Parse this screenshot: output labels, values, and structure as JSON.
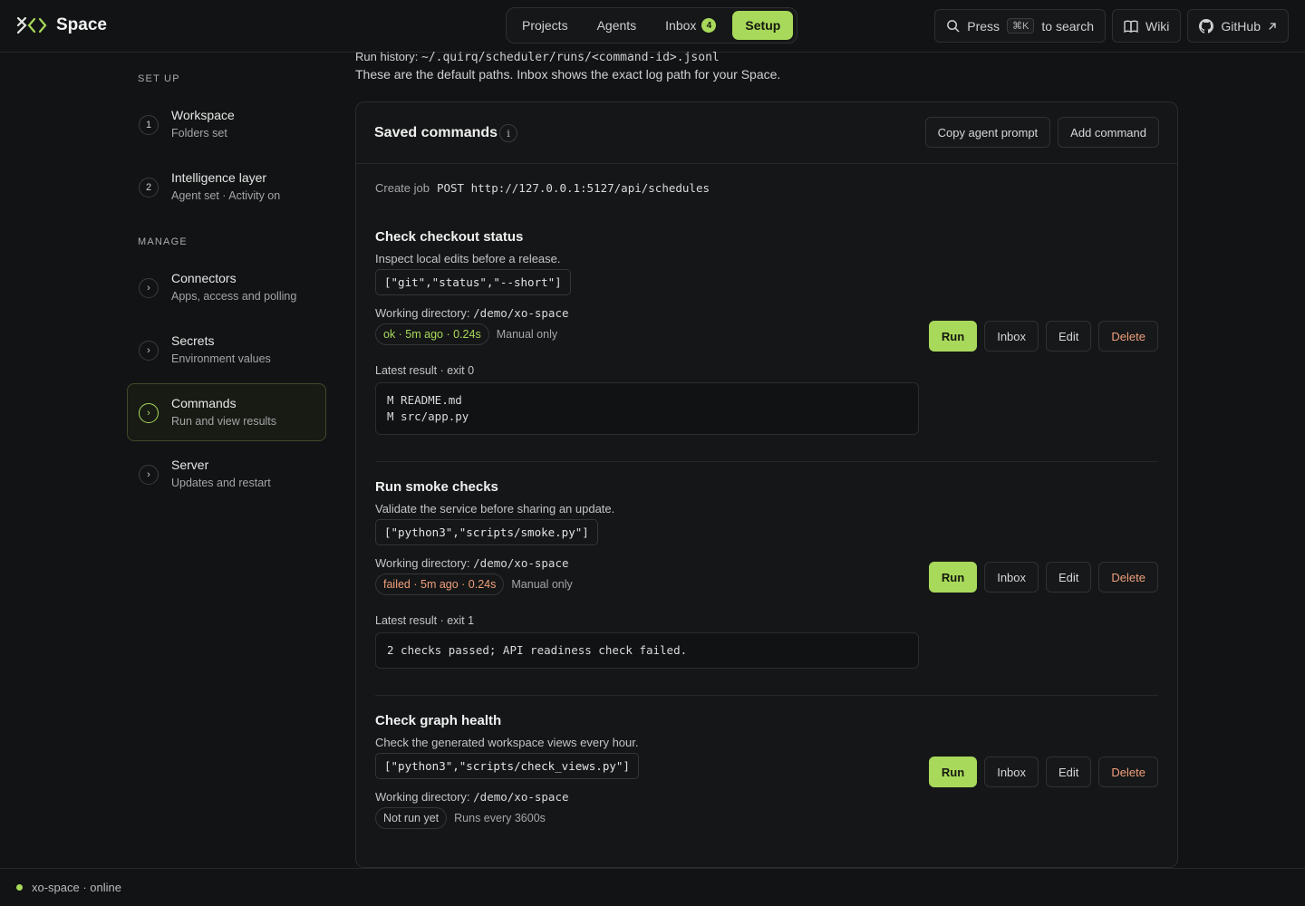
{
  "brand": {
    "name": "Space",
    "logo_icon": "xo-logo-icon",
    "accent": "#a8d95a"
  },
  "nav": {
    "tabs": [
      {
        "label": "Projects"
      },
      {
        "label": "Agents"
      },
      {
        "label": "Inbox",
        "badge": "4"
      },
      {
        "label": "Setup",
        "active": true
      }
    ]
  },
  "header": {
    "search": {
      "prefix": "Press",
      "shortcut": "⌘K",
      "suffix": "to search"
    },
    "wiki_label": "Wiki",
    "github_label": "GitHub"
  },
  "sidebar": {
    "setup_heading": "SET UP",
    "manage_heading": "MANAGE",
    "setup_items": [
      {
        "marker": "1",
        "title": "Workspace",
        "subtitle": "Folders set"
      },
      {
        "marker": "2",
        "title": "Intelligence layer",
        "subtitle": "Agent set · Activity on"
      }
    ],
    "manage_items": [
      {
        "marker": "›",
        "title": "Connectors",
        "subtitle": "Apps, access and polling"
      },
      {
        "marker": "›",
        "title": "Secrets",
        "subtitle": "Environment values"
      },
      {
        "marker": "›",
        "title": "Commands",
        "subtitle": "Run and view results",
        "active": true
      },
      {
        "marker": "›",
        "title": "Server",
        "subtitle": "Updates and restart"
      }
    ]
  },
  "main": {
    "run_history_label": "Run history:",
    "run_history_path": "~/.quirq/scheduler/runs/<command-id>.jsonl",
    "paths_note": "These are the default paths. Inbox shows the exact log path for your Space.",
    "card": {
      "title": "Saved commands",
      "info_glyph": "i",
      "copy_prompt_label": "Copy agent prompt",
      "add_command_label": "Add command",
      "create_job_label": "Create job",
      "create_job_endpoint": "POST http://127.0.0.1:5127/api/schedules"
    },
    "commands": [
      {
        "title": "Check checkout status",
        "description": "Inspect local edits before a release.",
        "argv": "[\"git\",\"status\",\"--short\"]",
        "workdir_label": "Working directory:",
        "workdir": "/demo/xo-space",
        "status": "ok · 5m ago · 0.24s",
        "status_kind": "ok",
        "schedule": "Manual only",
        "latest_label": "Latest result · exit 0",
        "result": "M README.md\nM src/app.py"
      },
      {
        "title": "Run smoke checks",
        "description": "Validate the service before sharing an update.",
        "argv": "[\"python3\",\"scripts/smoke.py\"]",
        "workdir_label": "Working directory:",
        "workdir": "/demo/xo-space",
        "status": "failed · 5m ago · 0.24s",
        "status_kind": "failed",
        "schedule": "Manual only",
        "latest_label": "Latest result · exit 1",
        "result": "2 checks passed; API readiness check failed."
      },
      {
        "title": "Check graph health",
        "description": "Check the generated workspace views every hour.",
        "argv": "[\"python3\",\"scripts/check_views.py\"]",
        "workdir_label": "Working directory:",
        "workdir": "/demo/xo-space",
        "status": "Not run yet",
        "status_kind": "neutral",
        "schedule": "Runs every 3600s"
      }
    ],
    "actions": {
      "run": "Run",
      "inbox": "Inbox",
      "edit": "Edit",
      "delete": "Delete"
    }
  },
  "footer": {
    "status_text": "xo-space · online",
    "status_color": "#a8d95a"
  }
}
